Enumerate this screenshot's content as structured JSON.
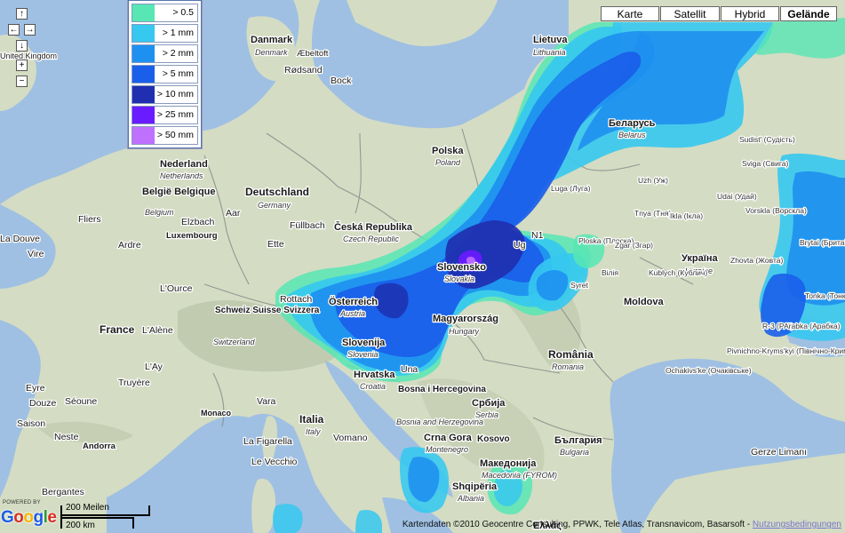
{
  "navigation": {
    "pan_up": "↑",
    "pan_left": "←",
    "pan_right": "→",
    "pan_down": "↓",
    "zoom_in": "+",
    "zoom_out": "−"
  },
  "legend": {
    "items": [
      {
        "label": "> 0.5 mm",
        "color": "#57e6b4"
      },
      {
        "label": "> 1 mm",
        "color": "#36c8ef"
      },
      {
        "label": "> 2 mm",
        "color": "#1e90f0"
      },
      {
        "label": "> 5 mm",
        "color": "#1a5fea"
      },
      {
        "label": "> 10 mm",
        "color": "#1f2fb0"
      },
      {
        "label": "> 25 mm",
        "color": "#6a1bff"
      },
      {
        "label": "> 50 mm",
        "color": "#c070ff"
      }
    ]
  },
  "map_types": {
    "karte": "Karte",
    "satellit": "Satellit",
    "hybrid": "Hybrid",
    "gelaende": "Gelände",
    "active": "Gelände"
  },
  "labels": {
    "countries": [
      {
        "name": "Danmark",
        "sub": "Denmark"
      },
      {
        "name": "Lietuva",
        "sub": "Lithuania"
      },
      {
        "name": "Беларусь",
        "sub": "Belarus"
      },
      {
        "name": "Polska",
        "sub": "Poland"
      },
      {
        "name": "Nederland",
        "sub": "Netherlands"
      },
      {
        "name": "België Belgique",
        "sub": "Belgium"
      },
      {
        "name": "Deutschland",
        "sub": "Germany"
      },
      {
        "name": "Česká Republika",
        "sub": "Czech Republic"
      },
      {
        "name": "Luxembourg",
        "sub": ""
      },
      {
        "name": "Slovensko",
        "sub": "Slovakia"
      },
      {
        "name": "Україна",
        "sub": "Ukraine"
      },
      {
        "name": "Moldova",
        "sub": ""
      },
      {
        "name": "Österreich",
        "sub": "Austria"
      },
      {
        "name": "Magyarország",
        "sub": "Hungary"
      },
      {
        "name": "France",
        "sub": ""
      },
      {
        "name": "Schweiz Suisse Svizzera",
        "sub": "Switzerland"
      },
      {
        "name": "Slovenija",
        "sub": "Slovenia"
      },
      {
        "name": "Hrvatska",
        "sub": "Croatia"
      },
      {
        "name": "România",
        "sub": "Romania"
      },
      {
        "name": "Bosna i Hercegovina",
        "sub": "Bosnia and Herzegovina"
      },
      {
        "name": "Србија",
        "sub": "Serbia"
      },
      {
        "name": "Crna Gora",
        "sub": "Montenegro"
      },
      {
        "name": "Kosovo",
        "sub": ""
      },
      {
        "name": "България",
        "sub": "Bulgaria"
      },
      {
        "name": "Monaco",
        "sub": ""
      },
      {
        "name": "Italia",
        "sub": "Italy"
      },
      {
        "name": "Andorra",
        "sub": ""
      },
      {
        "name": "Македонија",
        "sub": "Macedonia (FYROM)"
      },
      {
        "name": "Shqipëria",
        "sub": "Albania"
      },
      {
        "name": "Ελλάς",
        "sub": ""
      }
    ],
    "places": [
      "United Kingdom",
      "Æbeltoft",
      "Rødsand",
      "Bock",
      "Fliers",
      "Elzbach",
      "Aar",
      "Füllbach",
      "Ette",
      "Ardre",
      "Vire",
      "La Douve",
      "L'Ource",
      "L'Alène",
      "L'Ay",
      "Truyère",
      "Eyre",
      "Douze",
      "Séoune",
      "Saison",
      "Neste",
      "Bergantes",
      "Vara",
      "La Figarella",
      "Le Vecchio",
      "Vomano",
      "Rottach",
      "Una",
      "Ug",
      "N1",
      "Luga (Луга)",
      "Uzh (Уж)",
      "Udai (Удай)",
      "Sudist' (Судість)",
      "Sviga (Свига)",
      "Tnya (Тня)",
      "Ikla (Ікла)",
      "Vorskla (Ворскла)",
      "Ploska (Плоска)",
      "Zgar (Згар)",
      "Вілія",
      "Kublych (Кублич)",
      "Zhovta (Жовта)",
      "Brytai (Бритай)",
      "Syret",
      "Tonka (Тонка)",
      "R-3 (Р-3)",
      "Arabka (Арабка)",
      "Pivnichno-Kryms'kyi (Північно-Кримський)",
      "Ochakivs'ke (Очаківське)",
      "Gerze Limanı",
      "Le Vecchio"
    ]
  },
  "scale": {
    "top_label": "200 Meilen",
    "bottom_label": "200 km"
  },
  "footer": {
    "powered_by": "POWERED BY",
    "logo": "Google",
    "attribution": "Kartendaten ©2010 Geocentre Consulting, PPWK, Tele Atlas, Transnavicom, Basarsoft - ",
    "terms_link": "Nutzungsbedingungen"
  }
}
